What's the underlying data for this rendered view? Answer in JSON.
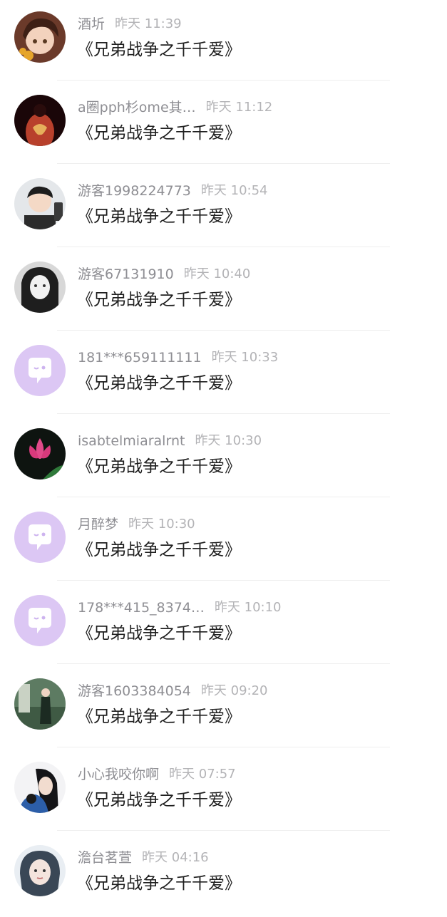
{
  "colors": {
    "default_avatar_bg": "#dcc7f4",
    "default_avatar_fg": "#ffffff"
  },
  "messages": [
    {
      "name": "酒圻",
      "time": "昨天 11:39",
      "text": "《兄弟战争之千千爱》",
      "avatar": "photo-anime-girl"
    },
    {
      "name": "a圈pph杉ome其…",
      "time": "昨天 11:12",
      "text": "《兄弟战争之千千爱》",
      "avatar": "photo-tattoo-back"
    },
    {
      "name": "游客1998224773",
      "time": "昨天 10:54",
      "text": "《兄弟战争之千千爱》",
      "avatar": "photo-boy-selfie"
    },
    {
      "name": "游客67131910",
      "time": "昨天 10:40",
      "text": "《兄弟战争之千千爱》",
      "avatar": "photo-woman-bw"
    },
    {
      "name": "181***659111111",
      "time": "昨天 10:33",
      "text": "《兄弟战争之千千爱》",
      "avatar": "default-chat"
    },
    {
      "name": "isabtelmiaralrnt",
      "time": "昨天 10:30",
      "text": "《兄弟战争之千千爱》",
      "avatar": "photo-lotus"
    },
    {
      "name": "月醉梦",
      "time": "昨天 10:30",
      "text": "《兄弟战争之千千爱》",
      "avatar": "default-chat"
    },
    {
      "name": "178***415_8374…",
      "time": "昨天 10:10",
      "text": "《兄弟战争之千千爱》",
      "avatar": "default-chat"
    },
    {
      "name": "游客1603384054",
      "time": "昨天 09:20",
      "text": "《兄弟战争之千千爱》",
      "avatar": "photo-girl-outdoor"
    },
    {
      "name": "小心我咬你啊",
      "time": "昨天 07:57",
      "text": "《兄弟战争之千千爱》",
      "avatar": "photo-anime-cat"
    },
    {
      "name": "澹台茗萱",
      "time": "昨天 04:16",
      "text": "《兄弟战争之千千爱》",
      "avatar": "photo-woman-portrait"
    }
  ]
}
